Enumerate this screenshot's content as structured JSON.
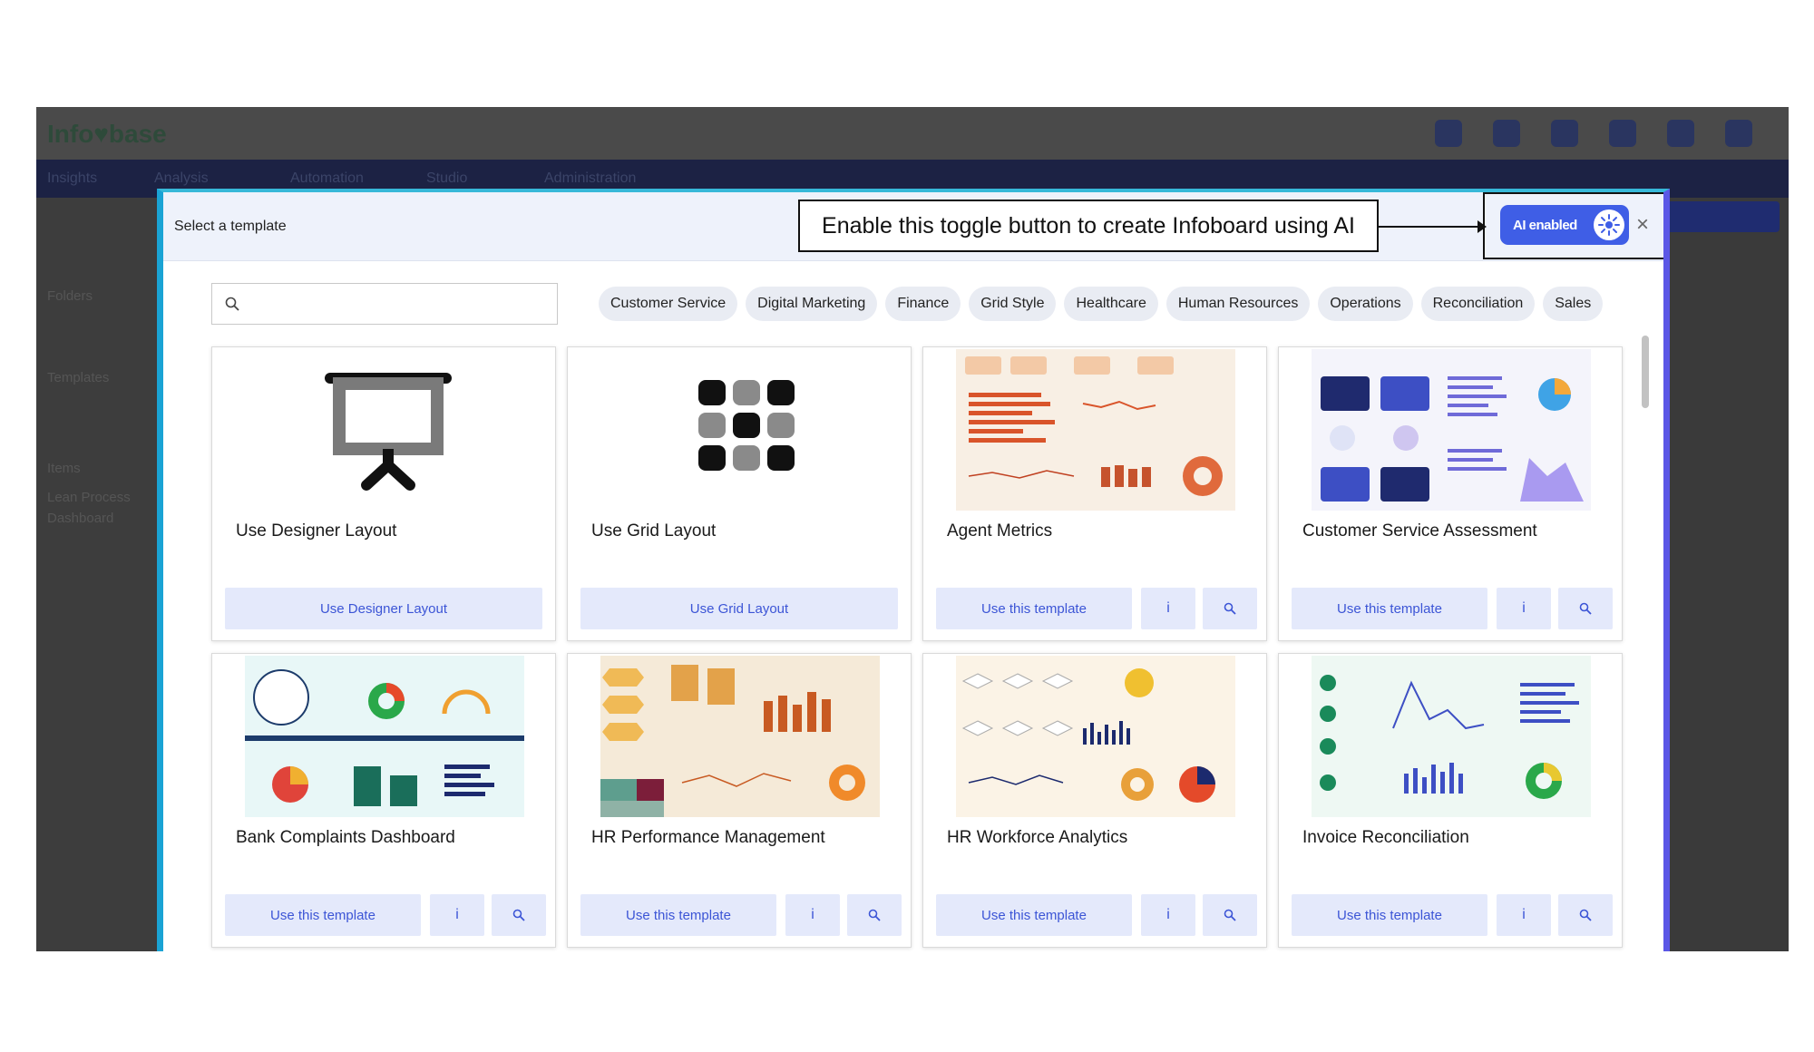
{
  "background_app": {
    "logo": "Info♥base",
    "nav_items": [
      "Insights",
      "Analysis",
      "Automation",
      "Studio",
      "Administration"
    ],
    "sidebar_labels": [
      "Folders",
      "Templates",
      "Items",
      "Lean Process",
      "Dashboard"
    ]
  },
  "modal": {
    "title": "Select a template",
    "callout_text": "Enable this toggle button to create Infoboard using AI",
    "ai_toggle_label": "AI enabled",
    "close_label": "×",
    "search_placeholder": "",
    "categories": [
      "Customer Service",
      "Digital Marketing",
      "Finance",
      "Grid Style",
      "Healthcare",
      "Human Resources",
      "Operations",
      "Reconciliation",
      "Sales"
    ]
  },
  "cards": [
    {
      "title": "Use Designer Layout",
      "button": "Use Designer Layout"
    },
    {
      "title": "Use Grid Layout",
      "button": "Use Grid Layout"
    },
    {
      "title": "Agent Metrics",
      "button": "Use this template",
      "info": "i"
    },
    {
      "title": "Customer Service Assessment",
      "button": "Use this template",
      "info": "i"
    },
    {
      "title": "Bank Complaints Dashboard",
      "button": "Use this template",
      "info": "i"
    },
    {
      "title": "HR Performance Management",
      "button": "Use this template",
      "info": "i"
    },
    {
      "title": "HR Workforce Analytics",
      "button": "Use this template",
      "info": "i"
    },
    {
      "title": "Invoice Reconciliation",
      "button": "Use this template",
      "info": "i"
    }
  ],
  "colors": {
    "accent": "#3f5ee6",
    "button_bg": "#e4e9fb",
    "button_text": "#3c55d6",
    "chip_bg": "#e9ecf3",
    "header_bg": "#eef2fb"
  },
  "icons": {
    "search": "search-icon",
    "ai": "sparkle-icon",
    "info": "info-icon",
    "zoom": "zoom-icon",
    "designer": "presentation-board-icon",
    "grid": "grid-layout-icon"
  }
}
